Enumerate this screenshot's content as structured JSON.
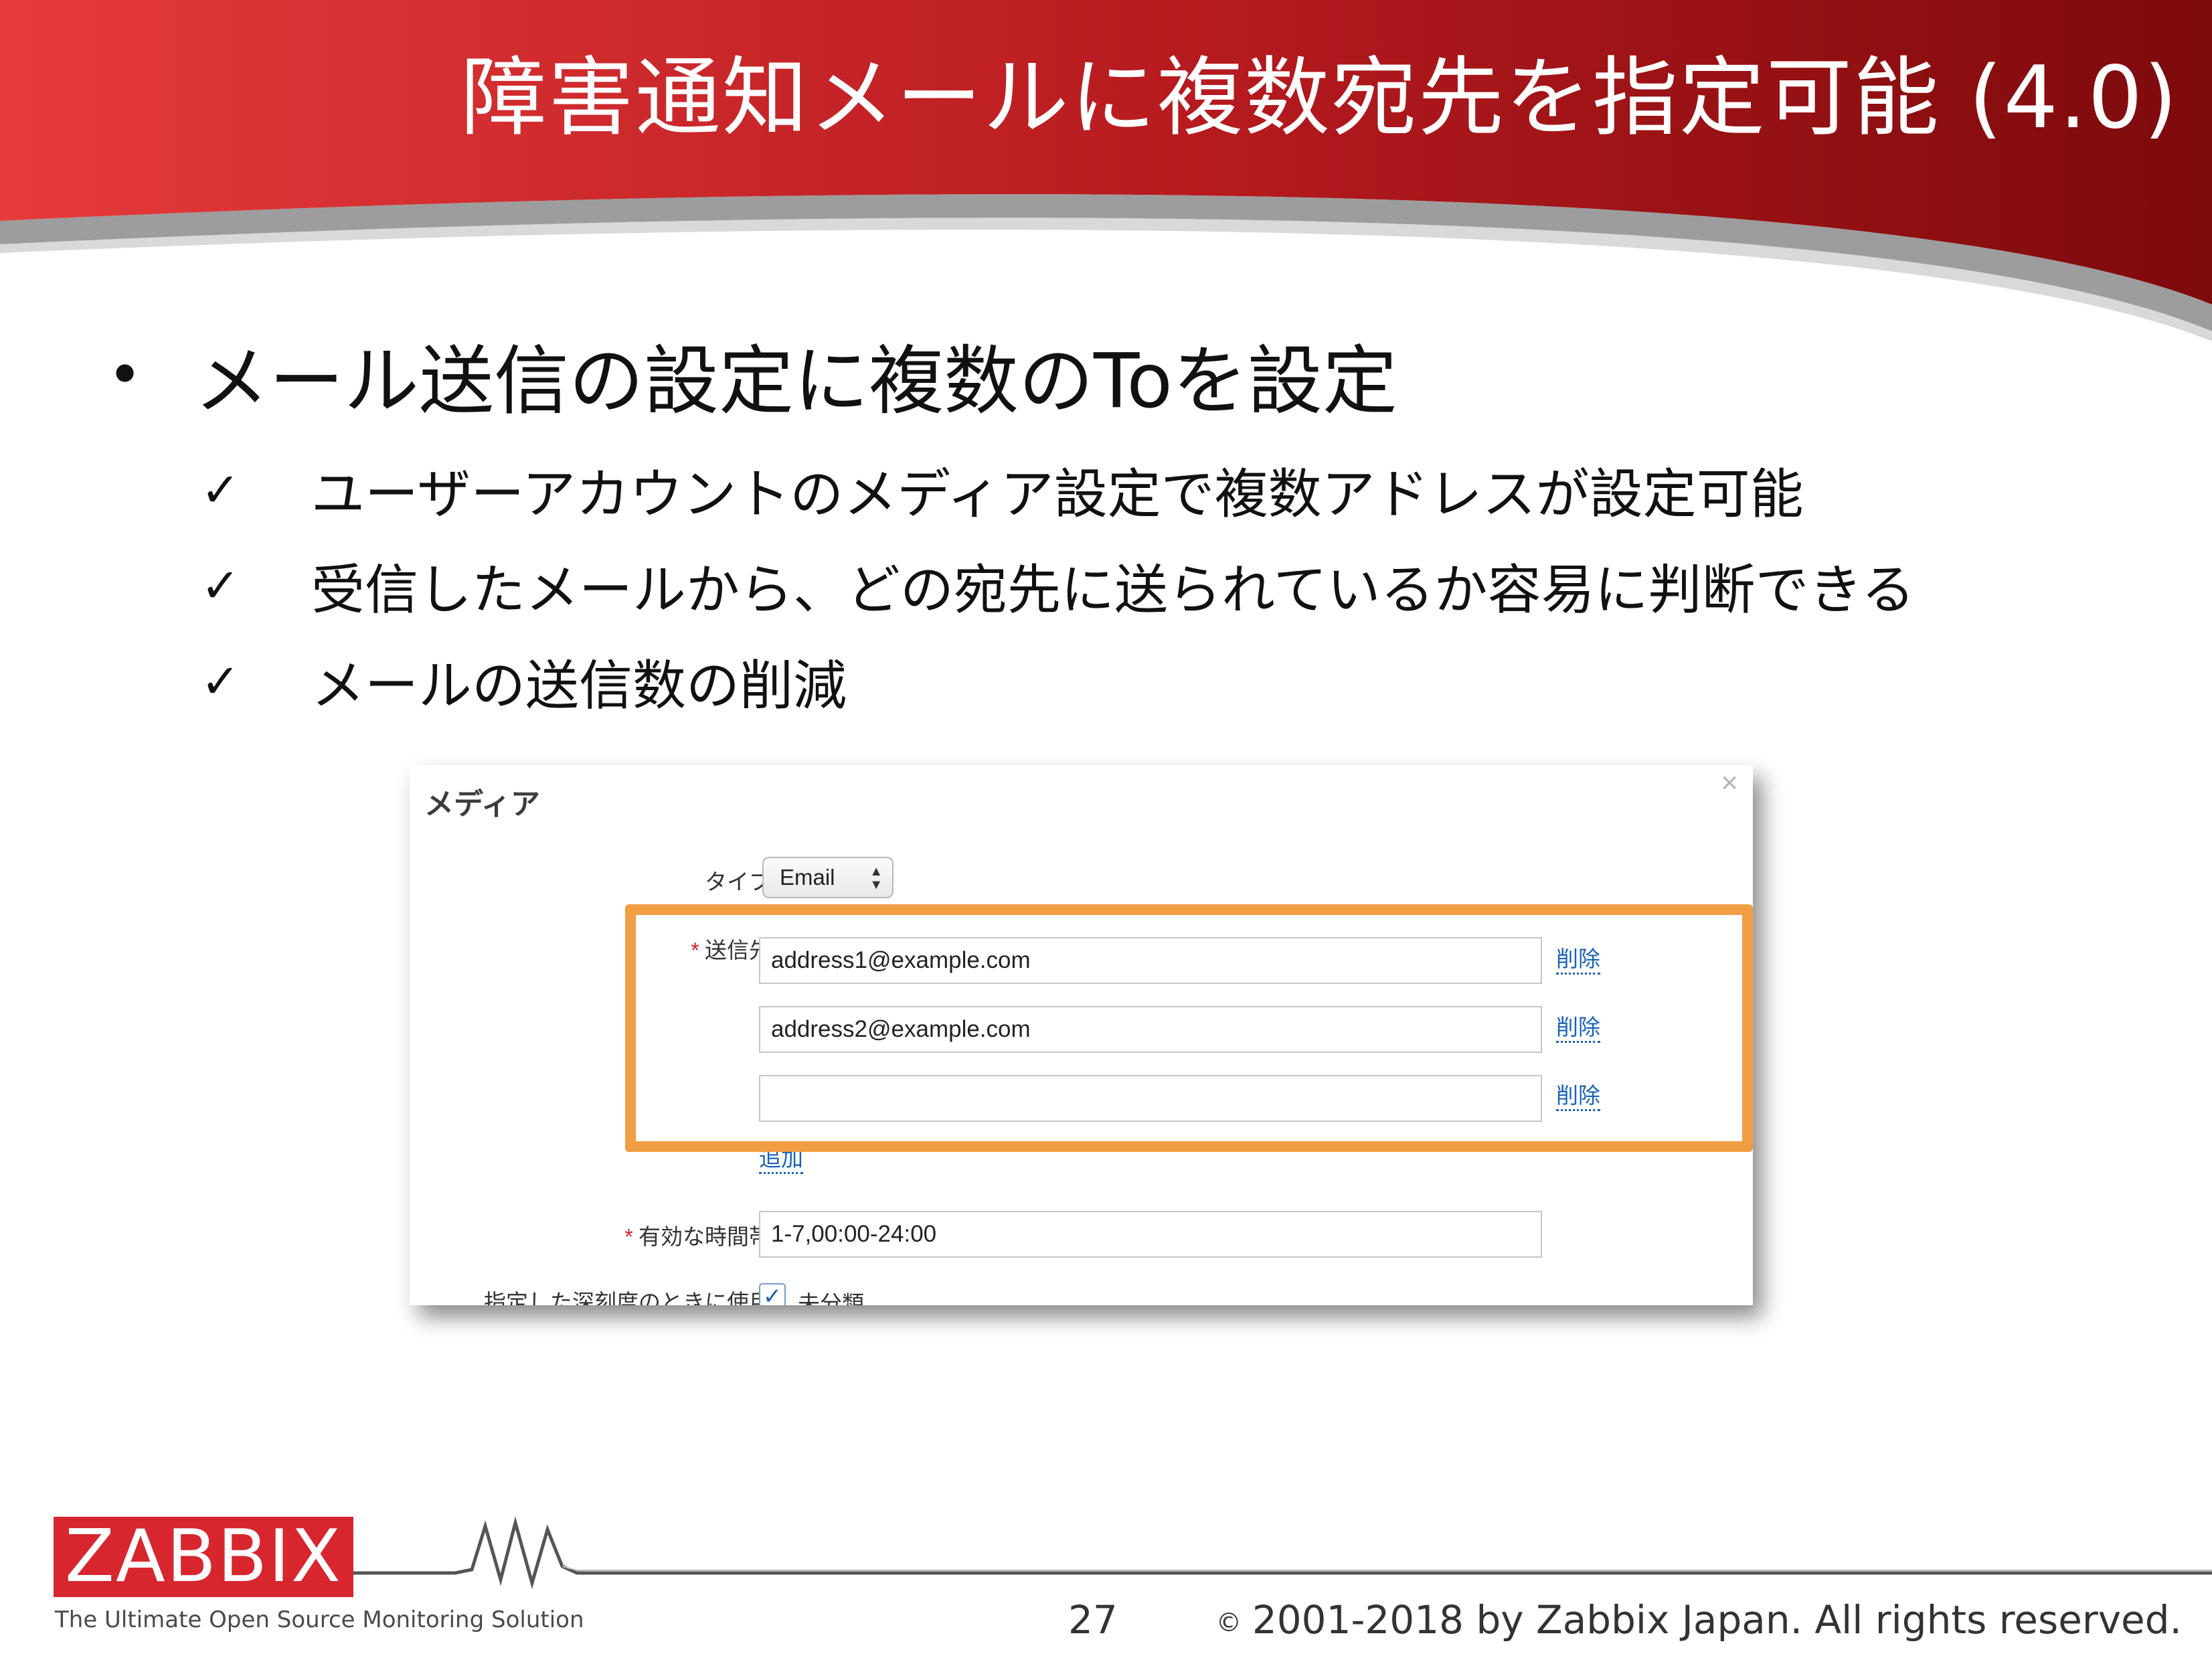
{
  "slide": {
    "title": "障害通知メールに複数宛先を指定可能 (4.0)",
    "bullet": "メール送信の設定に複数のToを設定",
    "bullet_marker": "•",
    "check_marker": "✓",
    "sub_items": [
      "ユーザーアカウントのメディア設定で複数アドレスが設定可能",
      "受信したメールから、どの宛先に送られているか容易に判断できる",
      "メールの送信数の削減"
    ]
  },
  "dialog": {
    "title": "メディア",
    "close_icon": "×",
    "type_label": "タイプ",
    "type_value": "Email",
    "send_to_label": "送信先",
    "required_marker": "*",
    "addresses": [
      "address1@example.com",
      "address2@example.com",
      ""
    ],
    "remove_label": "削除",
    "add_label": "追加",
    "when_active_label": "有効な時間帯",
    "when_active_value": "1-7,00:00-24:00",
    "use_if_severity_label": "指定した深刻度のときに使用",
    "severity_first": "未分類",
    "severity_checked": true
  },
  "footer": {
    "logo_text": "ZABBIX",
    "tagline": "The Ultimate Open Source Monitoring Solution",
    "page_number": "27",
    "copyright_sign": "©",
    "copyright": "2001-2018 by Zabbix Japan. All rights reserved."
  },
  "colors": {
    "header_red_left": "#e63a3b",
    "header_red_right": "#7d0a0c",
    "highlight_orange": "#f19d44",
    "link_blue": "#1a63b8",
    "logo_red": "#d8262e"
  }
}
